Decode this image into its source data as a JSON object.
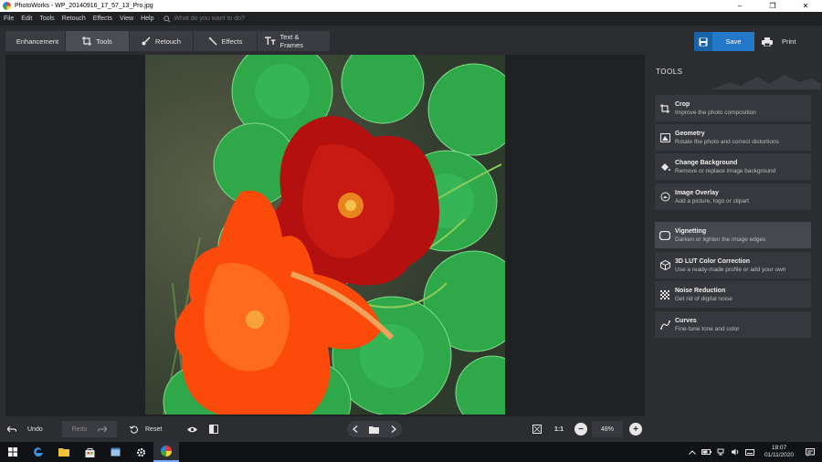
{
  "window": {
    "title": "PhotoWorks - WP_20140916_17_57_13_Pro.jpg",
    "controls": [
      "–",
      "❐",
      "✕"
    ]
  },
  "menu": {
    "items": [
      "File",
      "Edit",
      "Tools",
      "Retouch",
      "Effects",
      "View",
      "Help"
    ],
    "search_placeholder": "What do you want to do?"
  },
  "toolbar": {
    "tabs": [
      {
        "label": "Enhancement",
        "icon": "sliders-icon"
      },
      {
        "label": "Tools",
        "icon": "crop-icon",
        "active": true
      },
      {
        "label": "Retouch",
        "icon": "brush-icon"
      },
      {
        "label": "Effects",
        "icon": "magic-wand-icon"
      },
      {
        "label": "Text & Frames",
        "icon": "text-icon"
      }
    ],
    "save_label": "Save",
    "print_label": "Print"
  },
  "panel": {
    "title": "TOOLS",
    "tools": [
      {
        "name": "Crop",
        "desc": "Improve the photo composition",
        "icon": "crop-icon"
      },
      {
        "name": "Geometry",
        "desc": "Rotate the photo and correct distortions",
        "icon": "geometry-icon"
      },
      {
        "name": "Change Background",
        "desc": "Remove or replace image background",
        "icon": "paint-bucket-icon"
      },
      {
        "name": "Image Overlay",
        "desc": "Add a picture, logo or clipart",
        "icon": "overlay-icon"
      },
      {
        "name": "Vignetting",
        "desc": "Darken or lighten the image edges",
        "icon": "vignette-icon"
      },
      {
        "name": "3D LUT Color Correction",
        "desc": "Use a ready-made profile or add your own",
        "icon": "cube-icon"
      },
      {
        "name": "Noise Reduction",
        "desc": "Get rid of digital noise",
        "icon": "noise-icon"
      },
      {
        "name": "Curves",
        "desc": "Fine-tune tone and color",
        "icon": "curves-icon"
      }
    ]
  },
  "bottom": {
    "undo_label": "Undo",
    "redo_label": "Redo",
    "reset_label": "Reset",
    "one_to_one": "1:1",
    "zoom": "48%"
  },
  "taskbar": {
    "time": "18:07",
    "date": "01/11/2020"
  },
  "colors": {
    "accent": "#2378c8",
    "background": "#2b2d31",
    "canvas": "#202124"
  }
}
